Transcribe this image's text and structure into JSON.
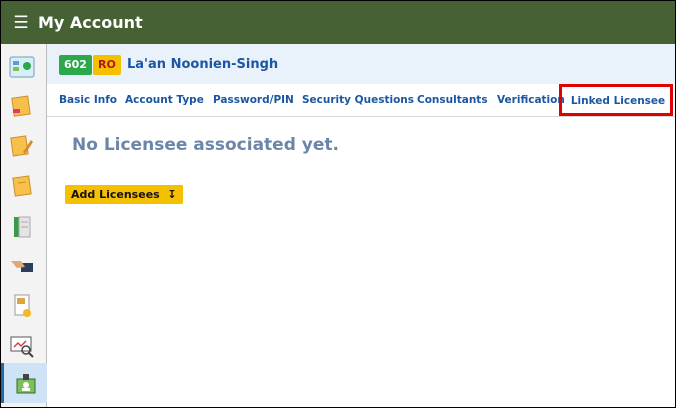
{
  "app": {
    "title": "My Account"
  },
  "header": {
    "badge_number": "602",
    "badge_role": "RO",
    "username": "La'an Noonien-Singh"
  },
  "tabs": [
    {
      "label": "Basic Info"
    },
    {
      "label": "Account Type"
    },
    {
      "label": "Password/PIN"
    },
    {
      "label": "Security Questions"
    },
    {
      "label": "Consultants"
    },
    {
      "label": "Verification"
    },
    {
      "label": "Linked Licensee"
    }
  ],
  "main": {
    "empty_message": "No Licensee associated yet.",
    "add_button_label": "Add Licensees"
  },
  "sidebar": {
    "items": [
      {
        "icon": "dashboard-icon"
      },
      {
        "icon": "notebook-icon"
      },
      {
        "icon": "edit-notebook-icon"
      },
      {
        "icon": "notes-icon"
      },
      {
        "icon": "book-icon"
      },
      {
        "icon": "handshake-icon"
      },
      {
        "icon": "document-icon"
      },
      {
        "icon": "search-report-icon"
      },
      {
        "icon": "account-card-icon"
      }
    ]
  }
}
